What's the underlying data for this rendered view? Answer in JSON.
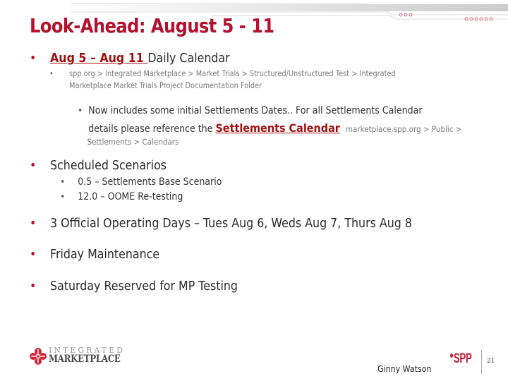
{
  "slide": {
    "title": "Look-Ahead: August 5 - 11",
    "page_number": "21",
    "presenter": "Ginny Watson",
    "accent_color": "#b3112e"
  },
  "bullets": {
    "calendar": {
      "link_text": "Aug 5 – Aug 11 ",
      "text": "Daily Calendar",
      "path_line1": "spp.org > Integrated Marketplace > Market Trials >  Structured/Unstructured  Test > Integrated",
      "path_line2": "Marketplace Market Trials Project Documentation Folder",
      "sub": {
        "line1_bold": "Now includes some initial ",
        "line1_rest": "Settlements Dates.. For all Settlements Calendar",
        "line2_bold": "details please reference the ",
        "line2_link": "Settlements Calendar",
        "line2_path": "marketplace.spp.org > Public >",
        "line3_path": "Settlements >  Calendars"
      }
    },
    "scenarios": {
      "heading": "Scheduled Scenarios",
      "items": [
        "0.5 – Settlements Base Scenario",
        "12.0  – OOME Re-testing"
      ]
    },
    "operating_days": "3 Official Operating Days – Tues Aug 6, Weds Aug 7, Thurs Aug 8",
    "maintenance": "Friday Maintenance",
    "saturday": "Saturday Reserved for MP Testing"
  },
  "logos": {
    "im_top": "INTEGRATED",
    "im_bottom": "MARKETPLACE",
    "spp": "SPP"
  },
  "icons": {
    "bullet": "•"
  }
}
